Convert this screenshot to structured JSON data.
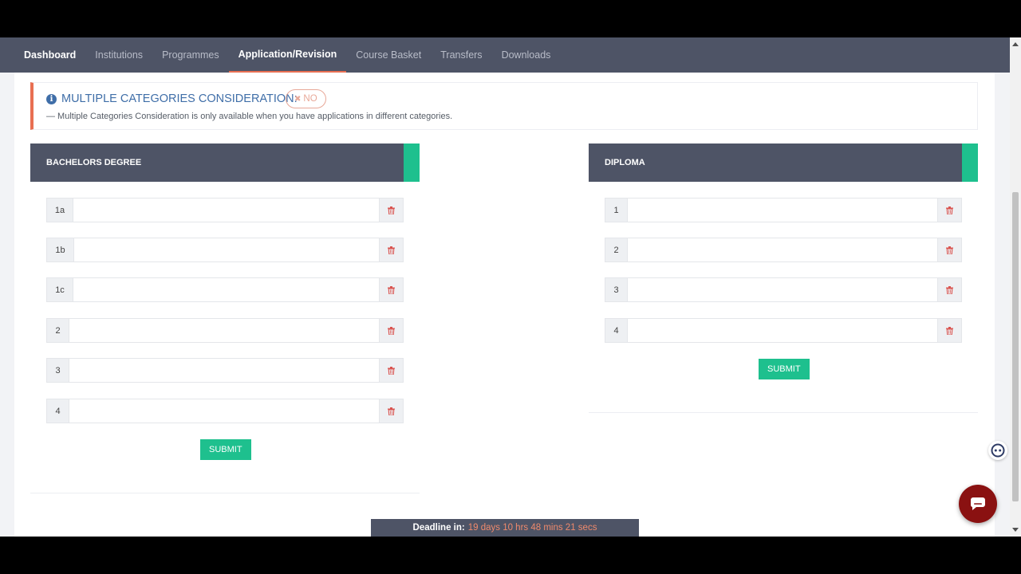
{
  "nav": {
    "items": [
      {
        "label": "Dashboard"
      },
      {
        "label": "Institutions"
      },
      {
        "label": "Programmes"
      },
      {
        "label": "Application/Revision"
      },
      {
        "label": "Course Basket"
      },
      {
        "label": "Transfers"
      },
      {
        "label": "Downloads"
      }
    ]
  },
  "notice": {
    "title": "MULTIPLE CATEGORIES CONSIDERATION:",
    "badge": "NO",
    "description": "— Multiple Categories Consideration is only available when you have applications in different categories."
  },
  "bachelors": {
    "title": "BACHELORS DEGREE",
    "choices": [
      "1a",
      "1b",
      "1c",
      "2",
      "3",
      "4"
    ],
    "submit": "SUBMIT"
  },
  "diploma": {
    "title": "DIPLOMA",
    "choices": [
      "1",
      "2",
      "3",
      "4"
    ],
    "submit": "SUBMIT"
  },
  "deadline": {
    "label": "Deadline in:",
    "value": "19 days 10 hrs 48 mins 21 secs"
  },
  "colors": {
    "nav_bg": "#4e5466",
    "accent_green": "#1ec08e",
    "accent_orange": "#e86f52",
    "info_blue": "#3f6ea8",
    "chat_red": "#8a1111"
  }
}
